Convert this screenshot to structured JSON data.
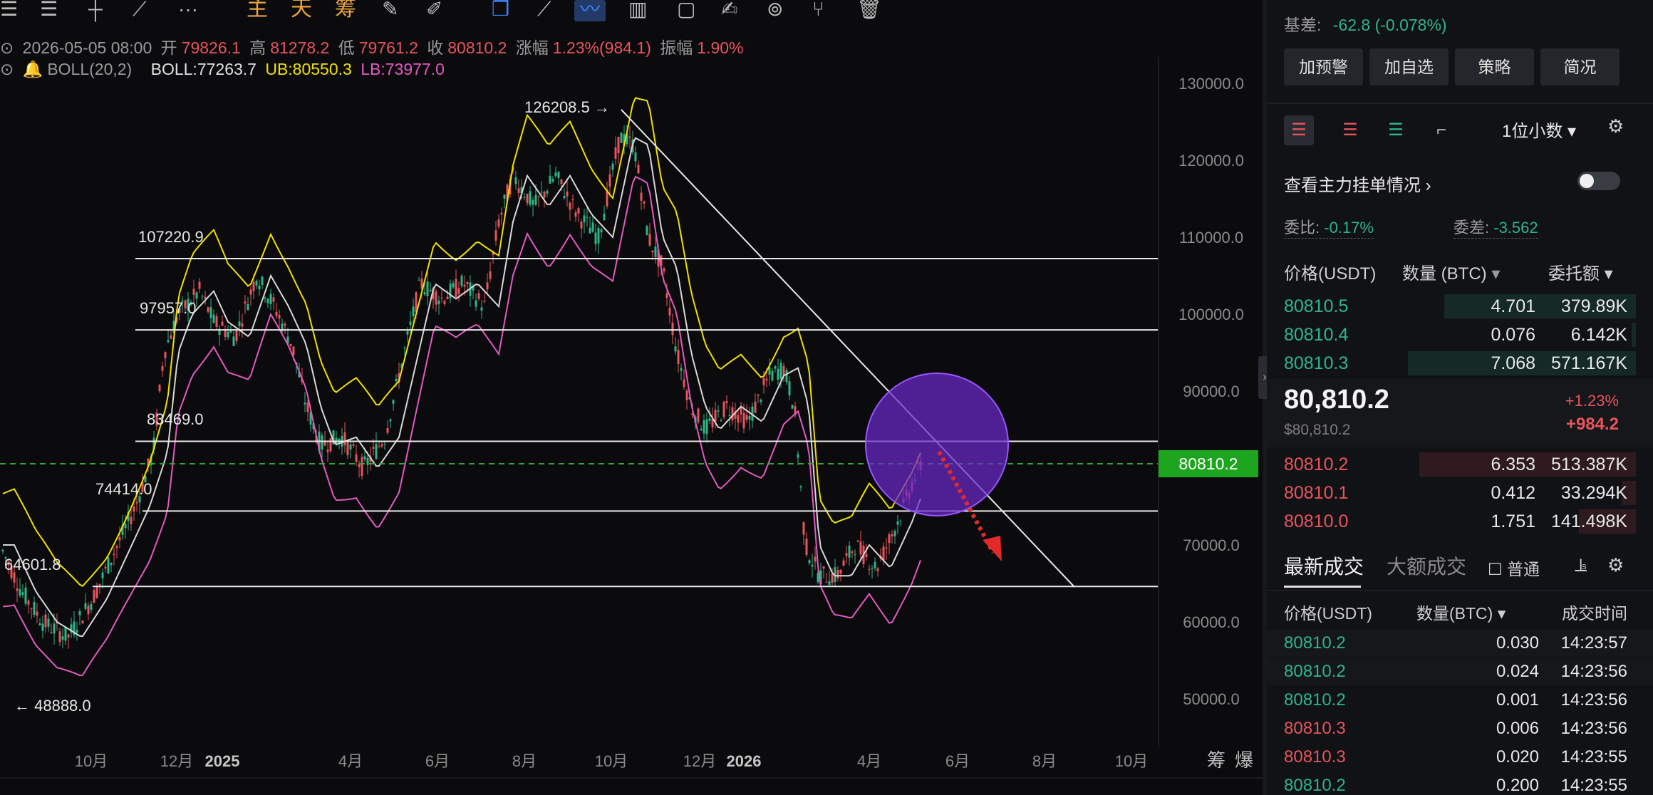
{
  "toolbar": {
    "icons": [
      "menu-icon",
      "list-icon",
      "crosshair-icon",
      "trendline-icon",
      "more-icon"
    ],
    "main_label": "主",
    "day_label": "天",
    "fund_label": "筹"
  },
  "ohlc": {
    "date": "2026-05-05 08:00",
    "open_label": "开",
    "open": "79826.1",
    "high_label": "高",
    "high": "81278.2",
    "low_label": "低",
    "low": "79761.2",
    "close_label": "收",
    "close": "80810.2",
    "change_label": "涨幅",
    "change": "1.23%(984.1)",
    "amp_label": "振幅",
    "amp": "1.90%"
  },
  "boll": {
    "name": "BOLL(20,2)",
    "mid": "BOLL:77263.7",
    "ub": "UB:80550.3",
    "lb": "LB:73977.0"
  },
  "chart_data": {
    "type": "candlestick",
    "y_axis_ticks": [
      "130000.0",
      "120000.0",
      "110000.0",
      "100000.0",
      "90000.0",
      "80000.0",
      "70000.0",
      "60000.0",
      "50000.0"
    ],
    "x_axis_ticks": [
      "10月",
      "12月",
      "2025",
      "4月",
      "6月",
      "8月",
      "10月",
      "12月",
      "2026",
      "4月",
      "6月",
      "8月",
      "10月"
    ],
    "current_price": "80810.2",
    "annotations": [
      "126208.5 →",
      "107220.9",
      "97957.0",
      "83469.0",
      "74414.0",
      "64601.8",
      "← 48888.0"
    ],
    "horizontal_levels": [
      107220.9,
      97957.0,
      83469.0,
      74414.0,
      64601.8
    ],
    "price_range": [
      45000,
      135000
    ],
    "series": [
      "candles",
      "BOLL",
      "UB",
      "LB"
    ],
    "bottom_right": [
      "筹",
      "爆"
    ]
  },
  "panel": {
    "basis_label": "基差:",
    "basis_value": "-62.8 (-0.078%)",
    "buttons": [
      "加预警",
      "加自选",
      "策略",
      "简况"
    ],
    "decimal_select": "1位小数",
    "main_orders_label": "查看主力挂单情况",
    "ratio_label": "委比:",
    "ratio_value": "-0.17%",
    "diff_label": "委差:",
    "diff_value": "-3.562",
    "ob_headers": [
      "价格(USDT)",
      "数量 (BTC)",
      "委托额"
    ],
    "asks": [
      {
        "price": "80810.5",
        "qty": "4.701",
        "amount": "379.89K",
        "depth": 0.84
      },
      {
        "price": "80810.4",
        "qty": "0.076",
        "amount": "6.142K",
        "depth": 0.02
      },
      {
        "price": "80810.3",
        "qty": "7.068",
        "amount": "571.167K",
        "depth": 1.0
      }
    ],
    "last_price": "80,810.2",
    "last_usd": "$80,810.2",
    "pct_change": "+1.23%",
    "abs_change": "+984.2",
    "bids": [
      {
        "price": "80810.2",
        "qty": "6.353",
        "amount": "513.387K",
        "depth": 0.95
      },
      {
        "price": "80810.1",
        "qty": "0.412",
        "amount": "33.294K",
        "depth": 0.06
      },
      {
        "price": "80810.0",
        "qty": "1.751",
        "amount": "141.498K",
        "depth": 0.25
      }
    ],
    "tabs": [
      "最新成交",
      "大额成交"
    ],
    "normal_label": "普通",
    "trade_headers": [
      "价格(USDT)",
      "数量(BTC)",
      "成交时间"
    ],
    "trades": [
      {
        "price": "80810.2",
        "qty": "0.030",
        "time": "14:23:57",
        "side": "buy"
      },
      {
        "price": "80810.2",
        "qty": "0.024",
        "time": "14:23:56",
        "side": "buy"
      },
      {
        "price": "80810.2",
        "qty": "0.001",
        "time": "14:23:56",
        "side": "buy"
      },
      {
        "price": "80810.3",
        "qty": "0.006",
        "time": "14:23:56",
        "side": "sell"
      },
      {
        "price": "80810.3",
        "qty": "0.020",
        "time": "14:23:55",
        "side": "sell"
      },
      {
        "price": "80810.2",
        "qty": "0.200",
        "time": "14:23:55",
        "side": "buy"
      }
    ]
  },
  "colors": {
    "up": "#2fb586",
    "down": "#e7545c",
    "boll_ub": "#f0e000",
    "boll_lb": "#e25ac0",
    "boll_mid": "#d8d8d8",
    "circle": "#6a27c9"
  }
}
